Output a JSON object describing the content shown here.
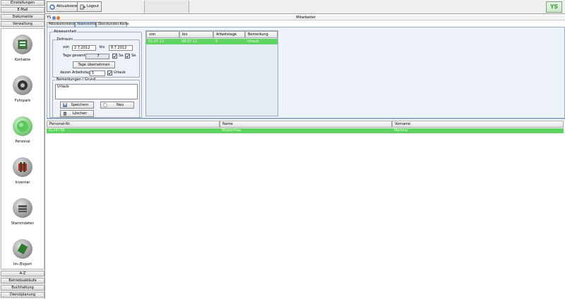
{
  "nav_top": [
    "Einstellungen",
    "E-Mail",
    "Dokumente",
    "Verwaltung"
  ],
  "modules": [
    {
      "label": "Kontakte",
      "icon": "contacts-icon"
    },
    {
      "label": "Fuhrpark",
      "icon": "fleet-icon"
    },
    {
      "label": "Personal",
      "icon": "personnel-icon"
    },
    {
      "label": "Inventar",
      "icon": "inventory-icon"
    },
    {
      "label": "Stammdaten",
      "icon": "master-data-icon"
    },
    {
      "label": "Im-/Export",
      "icon": "import-export-icon"
    }
  ],
  "nav_bottom": [
    "A-Z",
    "Betriebsabläufe",
    "Buchhaltung",
    "Dienstplanung"
  ],
  "toolbar": {
    "refresh_label": "Aktualisieren",
    "logout_label": "Logout",
    "logo_text": "YS"
  },
  "window": {
    "title": "Mitarbeiter",
    "user_abbrev": "YS"
  },
  "tabs": [
    "Mitarbeiterdaten",
    "Abwesenheit",
    "Überstunden-Konto"
  ],
  "form": {
    "group_title": "Abwesenheit",
    "period_title": "Zeitraum",
    "from_label": "von",
    "from_value": "2.7.2012",
    "to_label": "bis",
    "to_value": "8.7.2012",
    "total_days_label": "Tage gesamt",
    "total_days_value": "7",
    "sat_label": "Sa.",
    "sun_label": "So.",
    "apply_days_label": "Tage übernehmen",
    "workdays_label": "davon Arbeitstage",
    "workdays_value": "5",
    "vacation_label": "Urlaub",
    "remarks_title": "Bemerkungen / Grund",
    "remarks_value": "Urlaub",
    "save_label": "Speichern",
    "new_label": "Neu",
    "delete_label": "Löschen"
  },
  "absence_table": {
    "columns": [
      "von",
      "bis",
      "Arbeitstage",
      "Bemerkung"
    ],
    "rows": [
      [
        "02.07.12",
        "08.07.12",
        "5",
        "Urlaub"
      ]
    ]
  },
  "employee_table": {
    "columns": [
      "Personal-Nr.",
      "Name",
      "Vorname"
    ],
    "rows": [
      [
        "0124738",
        "Musterfrau",
        "Martina"
      ]
    ]
  },
  "colors": {
    "selected_row": "#5fd35f",
    "logo": "#1e8a1e",
    "active_tab": "#dbe8f6"
  }
}
